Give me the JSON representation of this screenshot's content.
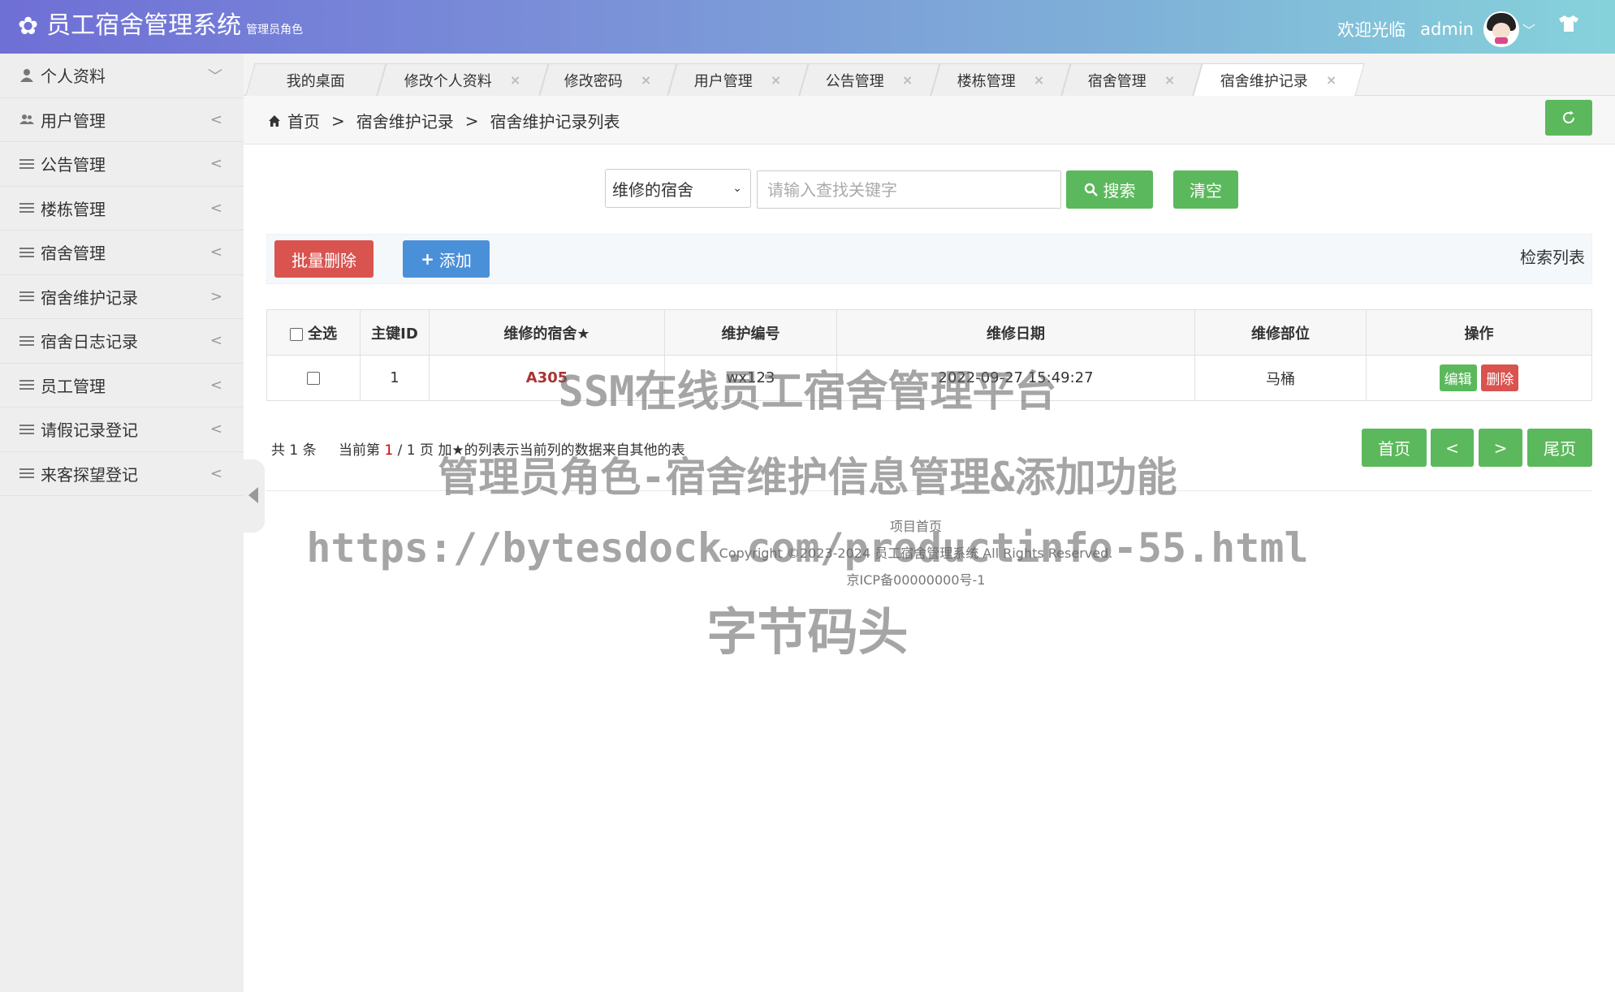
{
  "header": {
    "app_title": "员工宿舍管理系统",
    "role": "管理员角色",
    "welcome": "欢迎光临",
    "username": "admin"
  },
  "sidebar": {
    "items": [
      {
        "label": "个人资料",
        "arrow": "﹀",
        "icon": "user-icon"
      },
      {
        "label": "用户管理",
        "arrow": "<",
        "icon": "users-icon"
      },
      {
        "label": "公告管理",
        "arrow": "<",
        "icon": "menu-lines-icon"
      },
      {
        "label": "楼栋管理",
        "arrow": "<",
        "icon": "menu-lines-icon"
      },
      {
        "label": "宿舍管理",
        "arrow": "<",
        "icon": "menu-lines-icon"
      },
      {
        "label": "宿舍维护记录",
        "arrow": ">",
        "icon": "menu-lines-icon"
      },
      {
        "label": "宿舍日志记录",
        "arrow": "<",
        "icon": "menu-lines-icon"
      },
      {
        "label": "员工管理",
        "arrow": "<",
        "icon": "menu-lines-icon"
      },
      {
        "label": "请假记录登记",
        "arrow": "<",
        "icon": "menu-lines-icon"
      },
      {
        "label": "来客探望登记",
        "arrow": "<",
        "icon": "menu-lines-icon"
      }
    ]
  },
  "tabs": [
    {
      "label": "我的桌面",
      "close": ""
    },
    {
      "label": "修改个人资料",
      "close": "×"
    },
    {
      "label": "修改密码",
      "close": "×"
    },
    {
      "label": "用户管理",
      "close": "×"
    },
    {
      "label": "公告管理",
      "close": "×"
    },
    {
      "label": "楼栋管理",
      "close": "×"
    },
    {
      "label": "宿舍管理",
      "close": "×"
    },
    {
      "label": "宿舍维护记录",
      "close": "×"
    }
  ],
  "breadcrumb": {
    "home": "首页",
    "sep1": ">",
    "level1": "宿舍维护记录",
    "sep2": ">",
    "level2": "宿舍维护记录列表"
  },
  "search": {
    "field_selected": "维修的宿舍",
    "placeholder": "请输入查找关键字",
    "search_label": "搜索",
    "clear_label": "清空"
  },
  "toolbar": {
    "batch_delete": "批量删除",
    "add": "添加",
    "list_title": "检索列表"
  },
  "table": {
    "headers": [
      "全选",
      "主键ID",
      "维修的宿舍★",
      "维护编号",
      "维修日期",
      "维修部位",
      "操作"
    ],
    "rows": [
      {
        "id": "1",
        "dorm": "A305",
        "code": "wx123",
        "date": "2022-09-27 15:49:27",
        "part": "马桶",
        "edit": "编辑",
        "delete": "删除"
      }
    ]
  },
  "pagination": {
    "total": "共 1 条",
    "current_prefix": "当前第",
    "current": "1",
    "of": "/ 1 页",
    "note": "加★的列表示当前列的数据来自其他的表",
    "first": "首页",
    "prev": "<",
    "next": ">",
    "last": "尾页"
  },
  "footer": {
    "line1": "项目首页",
    "line2": "Copyright ©2023-2024 员工宿舍管理系统 All Rights Reserved.",
    "line3": "京ICP备00000000号-1"
  },
  "watermark": {
    "line1": "SSM在线员工宿舍管理平台",
    "line2": "管理员角色-宿舍维护信息管理&添加功能",
    "line3": "https://bytesdock.com/productinfo-55.html",
    "line4": "字节码头"
  },
  "colors": {
    "green": "#5cb85c",
    "red": "#d9534f",
    "blue": "#4a90d9"
  }
}
